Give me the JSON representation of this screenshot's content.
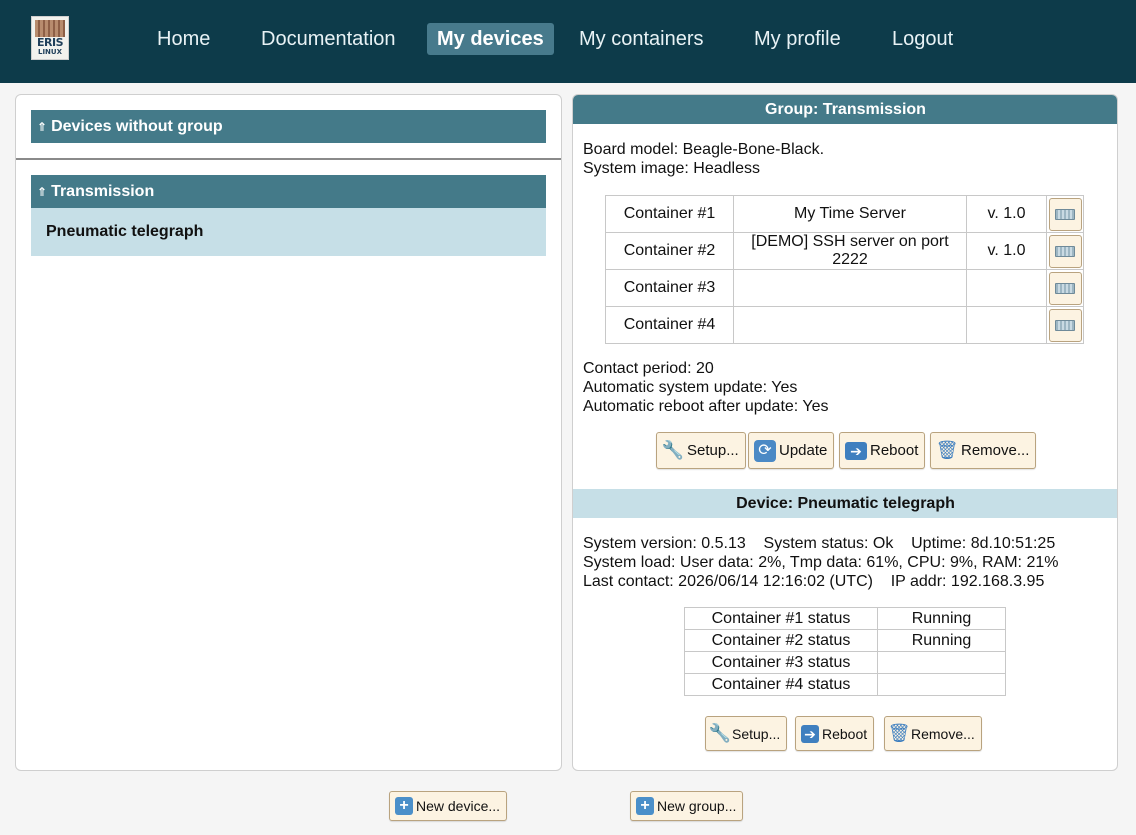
{
  "logo": {
    "line1": "ERIS",
    "line2": "LINUX"
  },
  "nav": {
    "home": "Home",
    "documentation": "Documentation",
    "my_devices": "My devices",
    "my_containers": "My containers",
    "my_profile": "My profile",
    "logout": "Logout"
  },
  "left_panel": {
    "groups": [
      {
        "label": "Devices without group",
        "arrow": "⇑"
      },
      {
        "label": "Transmission",
        "arrow": "⇑"
      }
    ],
    "device": "Pneumatic telegraph"
  },
  "group_panel": {
    "title": "Group: Transmission",
    "board_model": "Board model: Beagle-Bone-Black.",
    "system_image": "System image: Headless",
    "containers": [
      {
        "slot": "Container #1",
        "name": "My Time Server",
        "version": "v. 1.0"
      },
      {
        "slot": "Container #2",
        "name": "[DEMO] SSH server on port 2222",
        "version": "v. 1.0"
      },
      {
        "slot": "Container #3",
        "name": "",
        "version": ""
      },
      {
        "slot": "Container #4",
        "name": "",
        "version": ""
      }
    ],
    "contact_period": "Contact period: 20",
    "auto_update": "Automatic system update: Yes",
    "auto_reboot": "Automatic reboot after update: Yes",
    "buttons": {
      "setup": "Setup...",
      "update": "Update",
      "reboot": "Reboot",
      "remove": "Remove..."
    }
  },
  "device_panel": {
    "title": "Device: Pneumatic telegraph",
    "line1": "System version: 0.5.13    System status: Ok    Uptime: 8d.10:51:25",
    "line2": "System load: User data: 2%, Tmp data: 61%, CPU: 9%, RAM: 21%",
    "line3": "Last contact: 2026/06/14 12:16:02 (UTC)    IP addr: 192.168.3.95",
    "statuses": [
      {
        "label": "Container #1 status",
        "value": "Running"
      },
      {
        "label": "Container #2 status",
        "value": "Running"
      },
      {
        "label": "Container #3 status",
        "value": ""
      },
      {
        "label": "Container #4 status",
        "value": ""
      }
    ],
    "buttons": {
      "setup": "Setup...",
      "reboot": "Reboot",
      "remove": "Remove..."
    }
  },
  "footer": {
    "new_device": "New device...",
    "new_group": "New group..."
  }
}
